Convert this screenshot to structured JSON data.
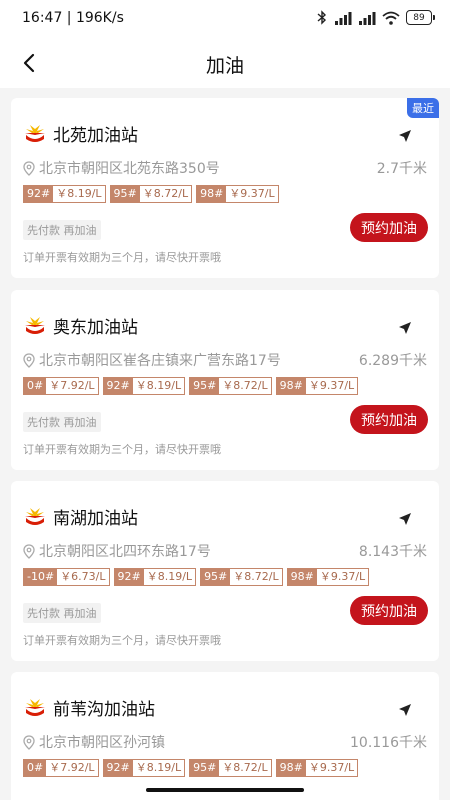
{
  "status_bar": {
    "time_speed": "16:47 | 196K/s",
    "battery": "89",
    "icons": [
      "bluetooth-icon",
      "signal-icon",
      "signal-icon",
      "wifi-icon",
      "battery-icon"
    ]
  },
  "header": {
    "title": "加油",
    "back_icon": "chevron-left-icon"
  },
  "colors": {
    "accent_red": "#c4141c",
    "price_tag": "#c4866a",
    "recent_badge": "#3b6fe8"
  },
  "stations": [
    {
      "name": "北苑加油站",
      "badge": "最近",
      "address": "北京市朝阳区北苑东路350号",
      "distance": "2.7千米",
      "prices": [
        {
          "grade": "92#",
          "price": "￥8.19/L"
        },
        {
          "grade": "95#",
          "price": "￥8.72/L"
        },
        {
          "grade": "98#",
          "price": "￥9.37/L"
        }
      ],
      "prepay": "先付款 再加油",
      "button": "预约加油",
      "note": "订单开票有效期为三个月，请尽快开票哦"
    },
    {
      "name": "奥东加油站",
      "address": "北京市朝阳区崔各庄镇来广营东路17号",
      "distance": "6.289千米",
      "prices": [
        {
          "grade": "0#",
          "price": "￥7.92/L"
        },
        {
          "grade": "92#",
          "price": "￥8.19/L"
        },
        {
          "grade": "95#",
          "price": "￥8.72/L"
        },
        {
          "grade": "98#",
          "price": "￥9.37/L"
        }
      ],
      "prepay": "先付款 再加油",
      "button": "预约加油",
      "note": "订单开票有效期为三个月，请尽快开票哦"
    },
    {
      "name": "南湖加油站",
      "address": "北京朝阳区北四环东路17号",
      "distance": "8.143千米",
      "prices": [
        {
          "grade": "-10#",
          "price": "￥6.73/L"
        },
        {
          "grade": "92#",
          "price": "￥8.19/L"
        },
        {
          "grade": "95#",
          "price": "￥8.72/L"
        },
        {
          "grade": "98#",
          "price": "￥9.37/L"
        }
      ],
      "prepay": "先付款 再加油",
      "button": "预约加油",
      "note": "订单开票有效期为三个月，请尽快开票哦"
    },
    {
      "name": "前苇沟加油站",
      "address": "北京市朝阳区孙河镇",
      "distance": "10.116千米",
      "prices": [
        {
          "grade": "0#",
          "price": "￥7.92/L"
        },
        {
          "grade": "92#",
          "price": "￥8.19/L"
        },
        {
          "grade": "95#",
          "price": "￥8.72/L"
        },
        {
          "grade": "98#",
          "price": "￥9.37/L"
        }
      ]
    }
  ]
}
